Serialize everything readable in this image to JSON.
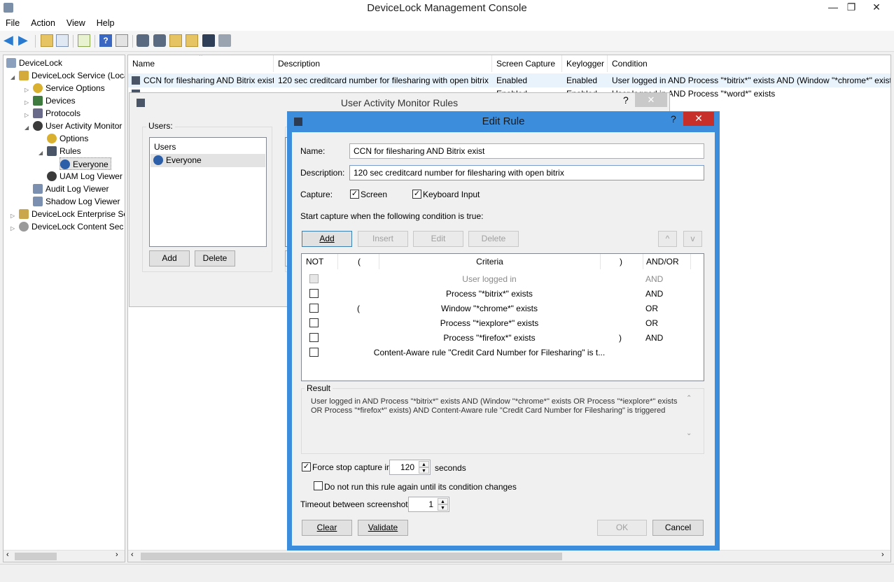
{
  "window": {
    "title": "DeviceLock Management Console"
  },
  "menu": [
    "File",
    "Action",
    "View",
    "Help"
  ],
  "tree": {
    "items": [
      {
        "label": "DeviceLock"
      },
      {
        "label": "DeviceLock Service (Local"
      },
      {
        "label": "Service Options"
      },
      {
        "label": "Devices"
      },
      {
        "label": "Protocols"
      },
      {
        "label": "User Activity Monitor"
      },
      {
        "label": "Options"
      },
      {
        "label": "Rules"
      },
      {
        "label": "Everyone"
      },
      {
        "label": "UAM Log Viewer"
      },
      {
        "label": "Audit Log Viewer"
      },
      {
        "label": "Shadow Log Viewer"
      },
      {
        "label": "DeviceLock Enterprise Se"
      },
      {
        "label": "DeviceLock Content Sec"
      }
    ]
  },
  "list": {
    "columns": [
      "Name",
      "Description",
      "Screen Capture",
      "Keylogger",
      "Condition"
    ],
    "rows": [
      {
        "name": "CCN for filesharing AND Bitrix exist",
        "description": "120 sec creditcard number for filesharing with open bitrix",
        "screen": "Enabled",
        "keylogger": "Enabled",
        "condition": "User logged in AND Process \"*bitrix*\" exists AND (Window \"*chrome*\" exist"
      },
      {
        "name": "",
        "description": "",
        "screen": "Enabled",
        "keylogger": "Enabled",
        "condition": "User logged in AND Process \"*word*\" exists"
      }
    ]
  },
  "uam_dialog": {
    "title": "User Activity Monitor Rules",
    "help": "?",
    "close": "✕",
    "users_label": "Users:",
    "users_header": "Users",
    "users": [
      "Everyone"
    ],
    "add": "Add",
    "delete": "Delete"
  },
  "edit_rule": {
    "title": "Edit Rule",
    "help": "?",
    "close": "✕",
    "name_label": "Name:",
    "name_value": "CCN for filesharing AND Bitrix exist",
    "desc_label": "Description:",
    "desc_value": "120 sec creditcard number for filesharing with open bitrix",
    "capture_label": "Capture:",
    "screen_label": "Screen",
    "keyboard_label": "Keyboard Input",
    "start_label": "Start capture when the following condition is true:",
    "buttons": {
      "add": "Add",
      "insert": "Insert",
      "edit": "Edit",
      "delete": "Delete",
      "up": "^",
      "down": "v"
    },
    "grid_headers": {
      "not": "NOT",
      "open": "(",
      "criteria": "Criteria",
      "close": ")",
      "andor": "AND/OR"
    },
    "conditions": [
      {
        "open": "",
        "criteria": "User logged in",
        "close": "",
        "andor": "AND",
        "disabled": true
      },
      {
        "open": "",
        "criteria": "Process \"*bitrix*\" exists",
        "close": "",
        "andor": "AND",
        "disabled": false
      },
      {
        "open": "(",
        "criteria": "Window \"*chrome*\" exists",
        "close": "",
        "andor": "OR",
        "disabled": false
      },
      {
        "open": "",
        "criteria": "Process \"*iexplore*\" exists",
        "close": "",
        "andor": "OR",
        "disabled": false
      },
      {
        "open": "",
        "criteria": "Process \"*firefox*\" exists",
        "close": ")",
        "andor": "AND",
        "disabled": false
      },
      {
        "open": "",
        "criteria": "Content-Aware rule \"Credit Card Number for Filesharing\" is t...",
        "close": "",
        "andor": "",
        "disabled": false
      }
    ],
    "result_label": "Result",
    "result_line1": "User logged in AND Process \"*bitrix*\" exists AND (Window \"*chrome*\" exists OR Process \"*iexplore*\" exists",
    "result_line2": "OR Process \"*firefox*\" exists) AND Content-Aware rule \"Credit Card Number for Filesharing\" is triggered",
    "force_stop_label": "Force stop capture in",
    "force_stop_value": "120",
    "seconds_label": "seconds",
    "no_rerun_label": "Do not run this rule again until its condition changes",
    "timeout_label": "Timeout between screenshots:",
    "timeout_value": "1",
    "clear": "Clear",
    "validate": "Validate",
    "ok": "OK",
    "cancel": "Cancel"
  },
  "colors": {
    "accent": "#3c8ddc",
    "close_red": "#c7302a",
    "selection": "#cce8ff"
  }
}
